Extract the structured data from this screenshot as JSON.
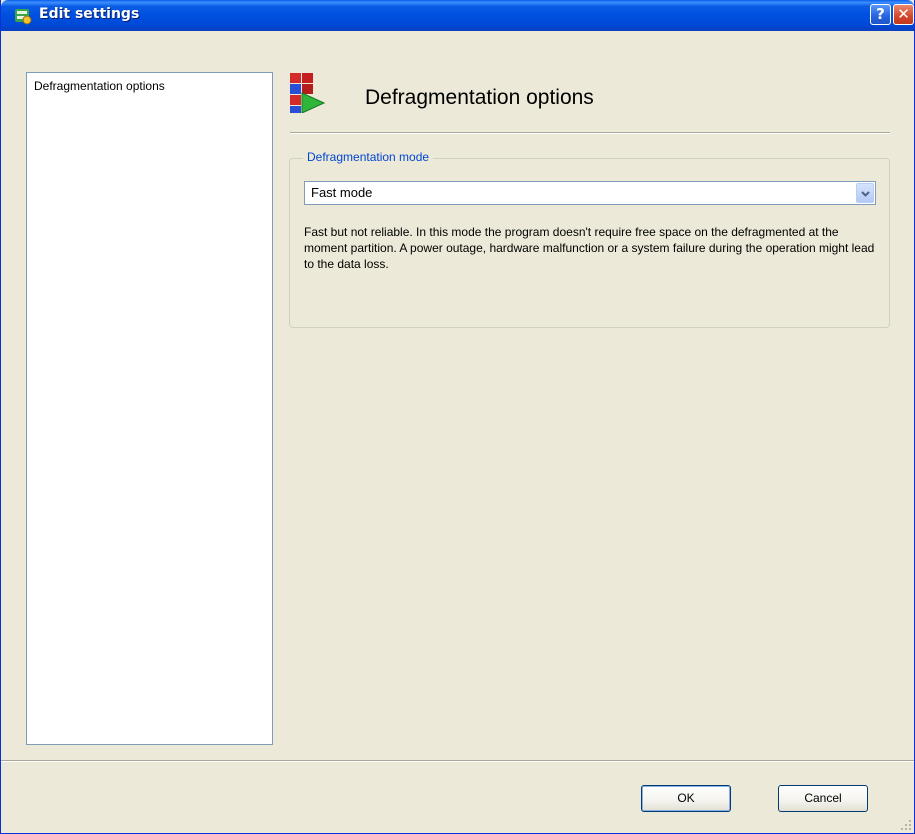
{
  "window": {
    "title": "Edit settings",
    "help_label": "?",
    "close_label": "✕",
    "app_icon": "settings-app-icon"
  },
  "sidebar": {
    "items": [
      {
        "label": "Defragmentation options",
        "selected": true
      }
    ]
  },
  "page": {
    "title": "Defragmentation options",
    "icon": "defrag-blocks-play-icon"
  },
  "mode_group": {
    "legend": "Defragmentation mode",
    "selected_value": "Fast mode",
    "description": "Fast but not reliable. In this mode the program doesn't require free space on the defragmented at the moment partition. A power outage, hardware malfunction or a system failure during the operation might lead to the data loss."
  },
  "buttons": {
    "ok_label": "OK",
    "cancel_label": "Cancel"
  },
  "colors": {
    "titlebar_blue": "#0050e0",
    "dialog_bg": "#ece9d8",
    "legend_blue": "#0046d5",
    "close_red": "#d4452a"
  }
}
